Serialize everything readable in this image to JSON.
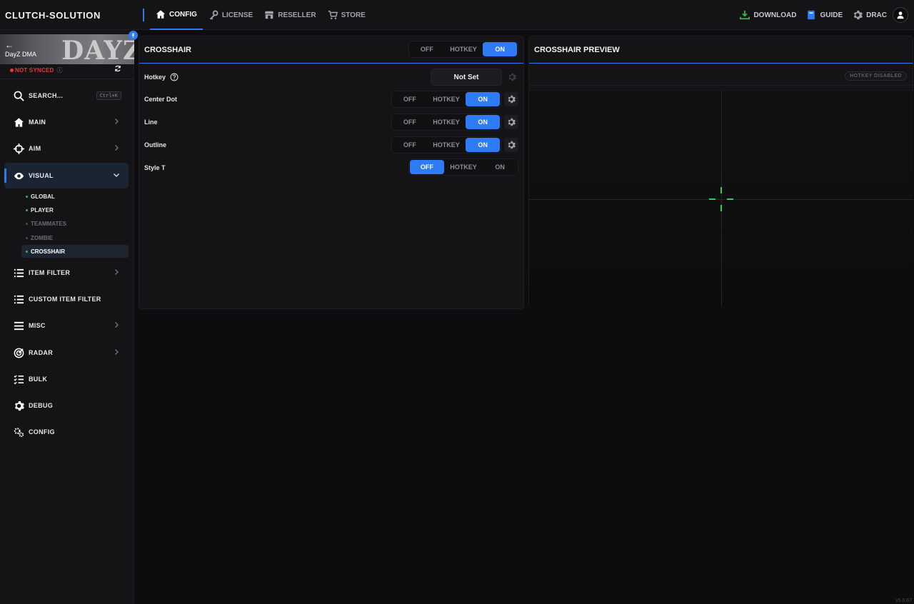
{
  "app": {
    "brand": "CLUTCH-SOLUTION",
    "version": "v5.0.67"
  },
  "topnav": {
    "items": [
      {
        "label": "CONFIG",
        "icon": "home-icon",
        "active": true
      },
      {
        "label": "LICENSE",
        "icon": "key-icon",
        "active": false
      },
      {
        "label": "RESELLER",
        "icon": "store-icon",
        "active": false
      },
      {
        "label": "STORE",
        "icon": "cart-icon",
        "active": false
      }
    ],
    "right": {
      "download": "DOWNLOAD",
      "guide": "GUIDE",
      "user": "DRAC"
    }
  },
  "sidebar": {
    "game": {
      "back": "←",
      "name": "DayZ DMA",
      "logo": "DAYZ"
    },
    "sync_status": "NOT SYNCED",
    "search": {
      "label": "SEARCH...",
      "shortcut": "Ctrl+K"
    },
    "items": [
      {
        "label": "MAIN",
        "icon": "home-icon"
      },
      {
        "label": "AIM",
        "icon": "crosshair-icon"
      },
      {
        "label": "VISUAL",
        "icon": "eye-icon",
        "active": true
      },
      {
        "label": "ITEM FILTER",
        "icon": "list-icon"
      },
      {
        "label": "CUSTOM ITEM FILTER",
        "icon": "list-icon"
      },
      {
        "label": "MISC",
        "icon": "menu-icon"
      },
      {
        "label": "RADAR",
        "icon": "radar-icon"
      },
      {
        "label": "BULK",
        "icon": "checklist-icon"
      },
      {
        "label": "DEBUG",
        "icon": "gear-icon"
      },
      {
        "label": "CONFIG",
        "icon": "gears-icon"
      }
    ],
    "visual_sub": [
      {
        "label": "GLOBAL"
      },
      {
        "label": "PLAYER"
      },
      {
        "label": "TEAMMATES"
      },
      {
        "label": "ZOMBIE"
      },
      {
        "label": "CROSSHAIR",
        "active": true
      }
    ]
  },
  "crosshair_panel": {
    "title": "CROSSHAIR",
    "header_toggle": {
      "off": "OFF",
      "hotkey": "HOTKEY",
      "on": "ON",
      "selected": "ON"
    },
    "hotkey": {
      "label": "Hotkey",
      "value": "Not Set"
    },
    "rows": [
      {
        "label": "Center Dot",
        "off": "OFF",
        "hotkey": "HOTKEY",
        "on": "ON",
        "selected": "ON"
      },
      {
        "label": "Line",
        "off": "OFF",
        "hotkey": "HOTKEY",
        "on": "ON",
        "selected": "ON"
      },
      {
        "label": "Outline",
        "off": "OFF",
        "hotkey": "HOTKEY",
        "on": "ON",
        "selected": "ON"
      },
      {
        "label": "Style T",
        "off": "OFF",
        "hotkey": "HOTKEY",
        "on": "ON",
        "selected": "OFF"
      }
    ]
  },
  "preview_panel": {
    "title": "CROSSHAIR PREVIEW",
    "badge": "HOTKEY DISABLED",
    "crosshair_color": "#2ed24a"
  },
  "colors": {
    "accent": "#2f7bf5",
    "danger": "#e23b3b",
    "download_green": "#3bb54a"
  }
}
